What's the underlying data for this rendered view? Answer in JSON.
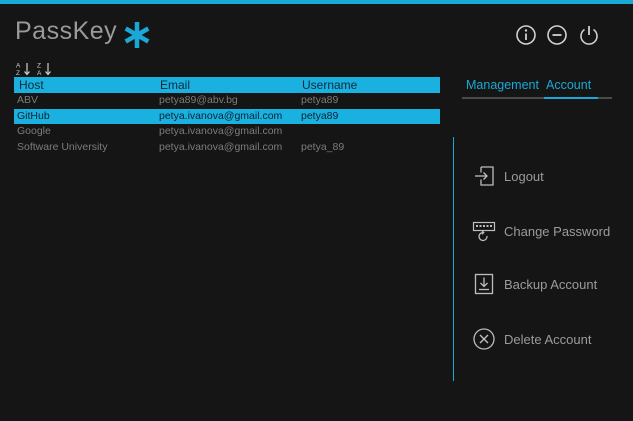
{
  "app": {
    "title": "PassKey"
  },
  "table": {
    "headers": {
      "host": "Host",
      "email": "Email",
      "username": "Username"
    },
    "rows": [
      {
        "host": "ABV",
        "email": "petya89@abv.bg",
        "username": "petya89"
      },
      {
        "host": "GitHub",
        "email": "petya.ivanova@gmail.com",
        "username": "petya89"
      },
      {
        "host": "Google",
        "email": "petya.ivanova@gmail.com",
        "username": ""
      },
      {
        "host": "Software University",
        "email": "petya.ivanova@gmail.com",
        "username": "petya_89"
      }
    ]
  },
  "tabs": {
    "management": "Management",
    "account": "Account"
  },
  "actions": {
    "logout": "Logout",
    "change_password": "Change Password",
    "backup": "Backup Account",
    "delete": "Delete Account"
  },
  "colors": {
    "accent": "#1aa8d6",
    "background": "#151515",
    "text_dim": "#7c7c7c",
    "title": "#9a9a9a"
  },
  "icons": [
    "asterisk-logo-icon",
    "info-icon",
    "minimize-icon",
    "power-icon",
    "sort-ascending-icon",
    "sort-descending-icon",
    "logout-icon",
    "keyboard-icon",
    "download-icon",
    "delete-icon"
  ]
}
